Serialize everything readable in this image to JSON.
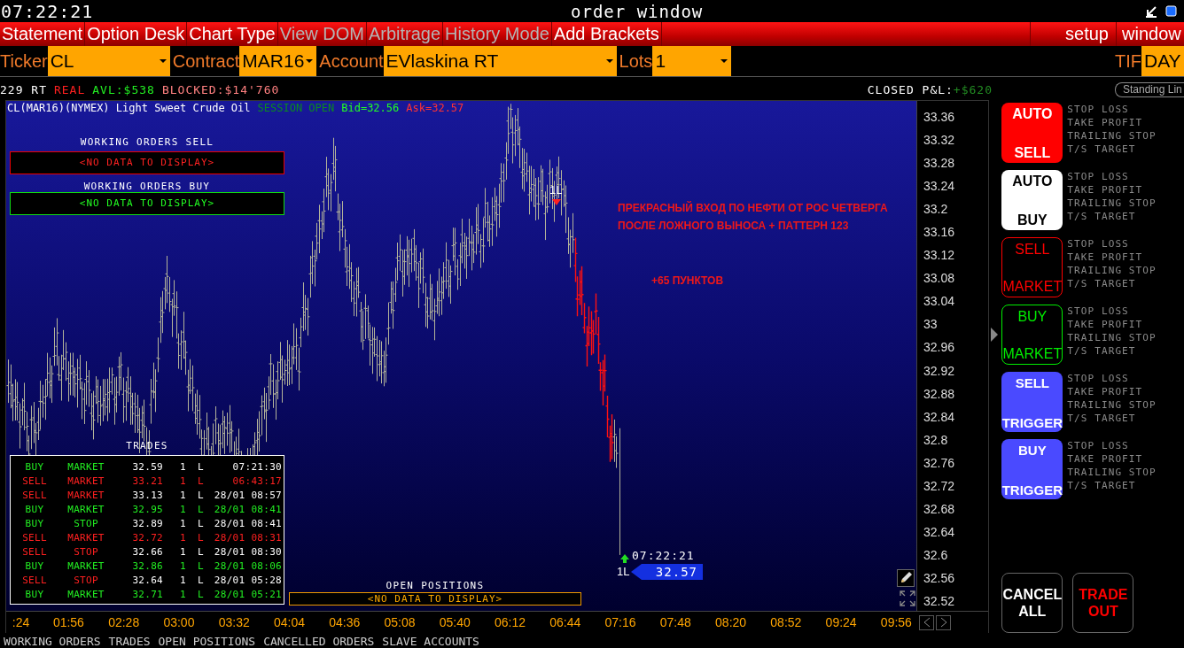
{
  "title_bar": {
    "clock": "07:22:21",
    "title": "order window"
  },
  "menu": [
    {
      "label": "Statement",
      "disabled": false
    },
    {
      "label": "Option Desk",
      "disabled": false
    },
    {
      "label": "Chart Type",
      "disabled": false
    },
    {
      "label": "View DOM",
      "disabled": true
    },
    {
      "label": "Arbitrage",
      "disabled": true
    },
    {
      "label": "History Mode",
      "disabled": true
    },
    {
      "label": "Add Brackets",
      "disabled": false
    }
  ],
  "menu_right": [
    "setup",
    "window"
  ],
  "order_fields": [
    {
      "label": "Ticker",
      "value": "CL",
      "kind": "ticker"
    },
    {
      "label": "Contract",
      "value": "MAR16",
      "kind": "contract"
    },
    {
      "label": "Account",
      "value": "EVlaskina RT",
      "kind": "account"
    },
    {
      "label": "Lots",
      "value": "1",
      "kind": "lots"
    }
  ],
  "tif": {
    "label": "TIF",
    "value": "DAY"
  },
  "account_line": [
    {
      "text": "229 RT",
      "color": "#ffffff"
    },
    {
      "text": "REAL",
      "color": "#ff2020"
    },
    {
      "text": "AVL:$538",
      "color": "#22ee22"
    },
    {
      "text": "BLOCKED:$14'760",
      "color": "#ff8080"
    }
  ],
  "closed_pnl": {
    "label": "CLOSED P&L:",
    "value": "+$620"
  },
  "standing_button": "Standing Lin",
  "chart": {
    "instrument": "CL(MAR16)(NYMEX) Light Sweet Crude Oil",
    "session": "SESSION OPEN",
    "bid": "Bid=32.56",
    "ask": "Ask=32.57",
    "annotation_lines": [
      "ПРЕКРАСНЫЙ ВХОД ПО НЕФТИ ОТ РОС ЧЕТВЕРГА",
      "ПОСЛЕ ЛОЖНОГО ВЫНОСА + ПАТТЕРН 123"
    ],
    "profit_note": "+65 ПУНКТОВ",
    "entry_marker": "1L",
    "last_marker": "1L",
    "last_time": "07:22:21",
    "last_price": "32.57",
    "y_labels": [
      "33.36",
      "33.32",
      "33.28",
      "33.24",
      "33.2",
      "33.16",
      "33.12",
      "33.08",
      "33.04",
      "33",
      "32.96",
      "32.92",
      "32.88",
      "32.84",
      "32.8",
      "32.76",
      "32.72",
      "32.68",
      "32.64",
      "32.6",
      "32.56",
      "32.52"
    ],
    "x_labels": [
      ":24",
      "01:56",
      "02:28",
      "03:00",
      "03:32",
      "04:04",
      "04:36",
      "05:08",
      "05:40",
      "06:12",
      "06:44",
      "07:16",
      "07:48",
      "08:20",
      "08:52",
      "09:24",
      "09:56"
    ]
  },
  "working_orders": [
    {
      "title": "WORKING ORDERS SELL",
      "message": "<NO DATA TO DISPLAY>",
      "kind": "sell"
    },
    {
      "title": "WORKING ORDERS BUY",
      "message": "<NO DATA TO DISPLAY>",
      "kind": "buy"
    }
  ],
  "trades": {
    "title": "TRADES",
    "rows": [
      {
        "side": "BUY",
        "type": "MARKET",
        "price": "32.59",
        "qty": "1",
        "dir": "L",
        "time": "07:21:30",
        "color": "#ffffff"
      },
      {
        "side": "SELL",
        "type": "MARKET",
        "price": "33.21",
        "qty": "1",
        "dir": "L",
        "time": "06:43:17",
        "color": "#ff2020"
      },
      {
        "side": "SELL",
        "type": "MARKET",
        "price": "33.13",
        "qty": "1",
        "dir": "L",
        "time": "28/01 08:57",
        "color": "#ffffff"
      },
      {
        "side": "BUY",
        "type": "MARKET",
        "price": "32.95",
        "qty": "1",
        "dir": "L",
        "time": "28/01 08:41",
        "color": "#22ee22"
      },
      {
        "side": "BUY",
        "type": "STOP",
        "price": "32.89",
        "qty": "1",
        "dir": "L",
        "time": "28/01 08:41",
        "color": "#ffffff"
      },
      {
        "side": "SELL",
        "type": "MARKET",
        "price": "32.72",
        "qty": "1",
        "dir": "L",
        "time": "28/01 08:31",
        "color": "#ff2020"
      },
      {
        "side": "SELL",
        "type": "STOP",
        "price": "32.66",
        "qty": "1",
        "dir": "L",
        "time": "28/01 08:30",
        "color": "#ffffff"
      },
      {
        "side": "BUY",
        "type": "MARKET",
        "price": "32.86",
        "qty": "1",
        "dir": "L",
        "time": "28/01 08:06",
        "color": "#22ee22"
      },
      {
        "side": "SELL",
        "type": "STOP",
        "price": "32.64",
        "qty": "1",
        "dir": "L",
        "time": "28/01 05:28",
        "color": "#ffffff"
      },
      {
        "side": "BUY",
        "type": "MARKET",
        "price": "32.71",
        "qty": "1",
        "dir": "L",
        "time": "28/01 05:21",
        "color": "#22ee22"
      }
    ]
  },
  "open_positions": {
    "title": "OPEN POSITIONS",
    "message": "<NO DATA TO DISPLAY>"
  },
  "order_buttons": [
    {
      "line1": "AUTO",
      "line2": "SELL",
      "kind": "auto_sell",
      "selected": false,
      "brackets": [
        "STOP LOSS",
        "TAKE PROFIT",
        "TRAILING STOP",
        "T/S TARGET"
      ]
    },
    {
      "line1": "AUTO",
      "line2": "BUY",
      "kind": "auto_buy",
      "selected": false,
      "brackets": [
        "STOP LOSS",
        "TAKE PROFIT",
        "TRAILING STOP",
        "T/S TARGET"
      ]
    },
    {
      "line1": "SELL",
      "line2": "MARKET",
      "kind": "sell_market",
      "selected": false,
      "brackets": [
        "STOP LOSS",
        "TAKE PROFIT",
        "TRAILING STOP",
        "T/S TARGET"
      ]
    },
    {
      "line1": "BUY",
      "line2": "MARKET",
      "kind": "buy_market",
      "selected": true,
      "brackets": [
        "STOP LOSS",
        "TAKE PROFIT",
        "TRAILING STOP",
        "T/S TARGET"
      ]
    },
    {
      "line1": "SELL",
      "line2": "TRIGGER",
      "kind": "sell_trigger",
      "selected": false,
      "brackets": [
        "STOP LOSS",
        "TAKE PROFIT",
        "TRAILING STOP",
        "T/S TARGET"
      ]
    },
    {
      "line1": "BUY",
      "line2": "TRIGGER",
      "kind": "buy_trigger",
      "selected": false,
      "brackets": [
        "STOP LOSS",
        "TAKE PROFIT",
        "TRAILING STOP",
        "T/S TARGET"
      ]
    }
  ],
  "action_buttons": [
    {
      "line1": "CANCEL",
      "line2": "ALL",
      "kind": "cancel"
    },
    {
      "line1": "TRADE",
      "line2": "OUT",
      "kind": "trade_out"
    }
  ],
  "bottom_tabs": [
    "WORKING ORDERS",
    "TRADES",
    "OPEN POSITIONS",
    "CANCELLED ORDERS",
    "SLAVE ACCOUNTS"
  ]
}
